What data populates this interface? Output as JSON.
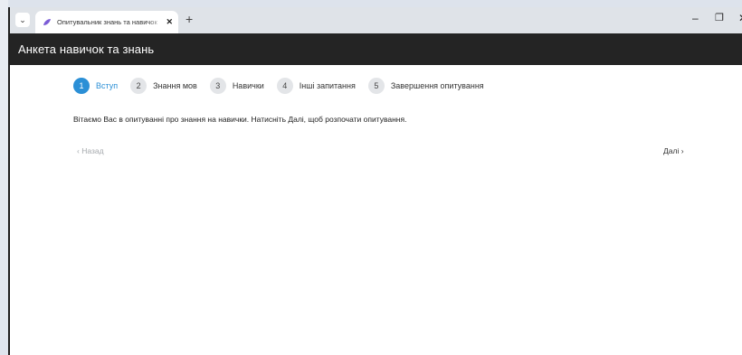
{
  "browser": {
    "tab_title": "Опитувальник знань та навичок",
    "tab_close": "✕",
    "new_tab": "+",
    "menu_icon": "⌄",
    "minimize": "–",
    "maximize": "❐",
    "close": "✕",
    "favicon_color": "#7b5cd6"
  },
  "app": {
    "title": "Анкета навичок та знань"
  },
  "steps": [
    {
      "num": "1",
      "label": "Вступ",
      "active": true
    },
    {
      "num": "2",
      "label": "Знання мов",
      "active": false
    },
    {
      "num": "3",
      "label": "Навички",
      "active": false
    },
    {
      "num": "4",
      "label": "Інші запитання",
      "active": false
    },
    {
      "num": "5",
      "label": "Завершення опитування",
      "active": false
    }
  ],
  "intro": {
    "text": "Вітаємо Вас в опитуванні про знання на навички. Натисніть Далі, щоб розпочати опитування."
  },
  "nav": {
    "back": "‹ Назад",
    "next": "Далі ›"
  },
  "colors": {
    "accent": "#2b8fd6",
    "header_bg": "#242424"
  }
}
